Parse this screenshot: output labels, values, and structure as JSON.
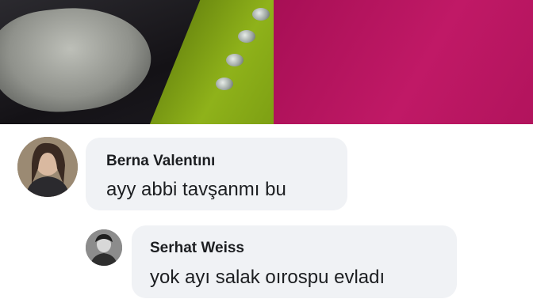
{
  "comments": [
    {
      "author": "Berna Valentını",
      "text": "ayy abbi tavşanmı bu",
      "avatar_icon": "user-avatar-photo"
    },
    {
      "author": "Serhat Weiss",
      "text": "yok ayı salak oırospu evladı",
      "avatar_icon": "user-avatar-photo"
    }
  ],
  "colors": {
    "bubble_bg": "#f0f2f5",
    "text": "#1c1e21",
    "photo_pink": "#b0125a",
    "photo_green": "#8fb21a"
  }
}
